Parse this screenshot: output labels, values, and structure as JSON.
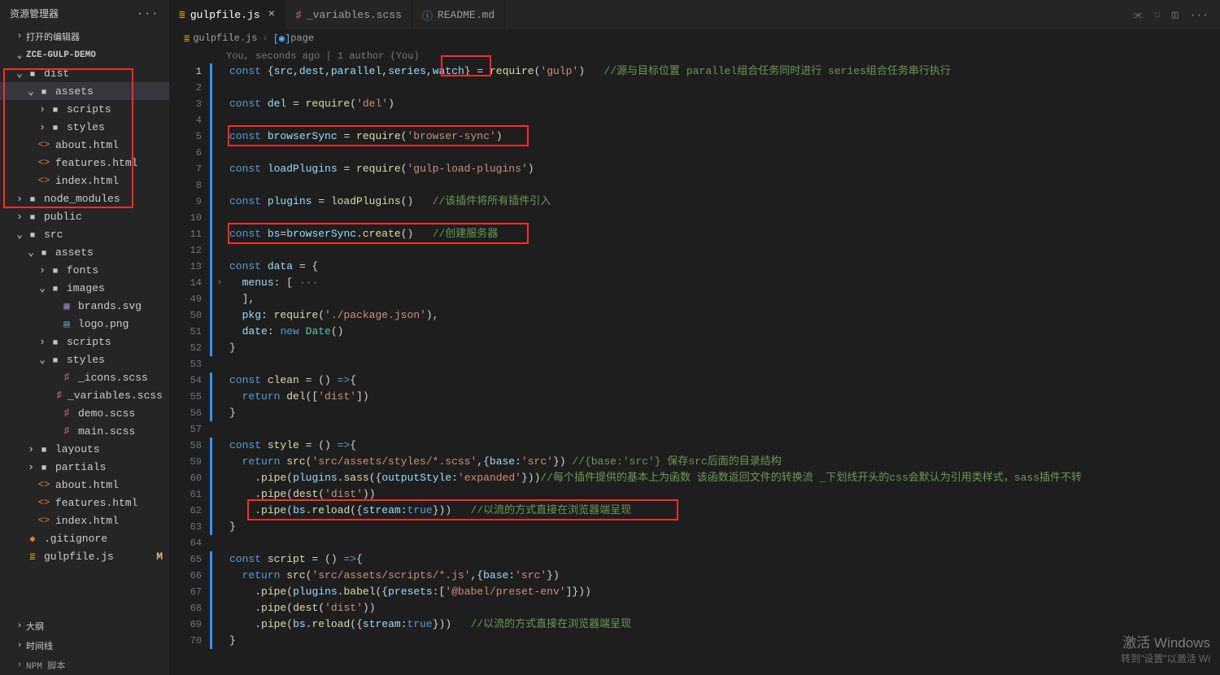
{
  "sidebar": {
    "title": "资源管理器",
    "open_editors": "打开的编辑器",
    "project": "ZCE-GULP-DEMO",
    "outline": "大纲",
    "timeline": "时间线",
    "npm": "NPM 脚本",
    "tree": [
      {
        "d": 1,
        "open": true,
        "icon": "folder",
        "label": "dist"
      },
      {
        "d": 2,
        "open": true,
        "icon": "folder",
        "label": "assets",
        "selected": true
      },
      {
        "d": 3,
        "open": false,
        "icon": "folder",
        "label": "scripts"
      },
      {
        "d": 3,
        "open": false,
        "icon": "folder",
        "label": "styles"
      },
      {
        "d": 2,
        "icon": "html",
        "label": "about.html"
      },
      {
        "d": 2,
        "icon": "html",
        "label": "features.html"
      },
      {
        "d": 2,
        "icon": "html",
        "label": "index.html"
      },
      {
        "d": 1,
        "open": false,
        "icon": "folder",
        "label": "node_modules"
      },
      {
        "d": 1,
        "open": false,
        "icon": "folder",
        "label": "public"
      },
      {
        "d": 1,
        "open": true,
        "icon": "folder",
        "label": "src"
      },
      {
        "d": 2,
        "open": true,
        "icon": "folder",
        "label": "assets"
      },
      {
        "d": 3,
        "open": false,
        "icon": "folder",
        "label": "fonts"
      },
      {
        "d": 3,
        "open": true,
        "icon": "folder",
        "label": "images"
      },
      {
        "d": 4,
        "icon": "svg",
        "label": "brands.svg"
      },
      {
        "d": 4,
        "icon": "png",
        "label": "logo.png"
      },
      {
        "d": 3,
        "open": false,
        "icon": "folder",
        "label": "scripts"
      },
      {
        "d": 3,
        "open": true,
        "icon": "folder",
        "label": "styles"
      },
      {
        "d": 4,
        "icon": "scss",
        "label": "_icons.scss"
      },
      {
        "d": 4,
        "icon": "scss",
        "label": "_variables.scss"
      },
      {
        "d": 4,
        "icon": "scss",
        "label": "demo.scss"
      },
      {
        "d": 4,
        "icon": "scss",
        "label": "main.scss"
      },
      {
        "d": 2,
        "open": false,
        "icon": "folder",
        "label": "layouts"
      },
      {
        "d": 2,
        "open": false,
        "icon": "folder",
        "label": "partials"
      },
      {
        "d": 2,
        "icon": "html",
        "label": "about.html"
      },
      {
        "d": 2,
        "icon": "html",
        "label": "features.html"
      },
      {
        "d": 2,
        "icon": "html",
        "label": "index.html"
      },
      {
        "d": 1,
        "icon": "git",
        "label": ".gitignore"
      },
      {
        "d": 1,
        "icon": "js",
        "label": "gulpfile.js",
        "mod": true
      }
    ]
  },
  "tabs": [
    {
      "icon": "js",
      "label": "gulpfile.js",
      "active": true,
      "close": true
    },
    {
      "icon": "scss",
      "label": "_variables.scss"
    },
    {
      "icon": "info",
      "label": "README.md"
    }
  ],
  "breadcrumb": {
    "file": "gulpfile.js",
    "symbol": "page"
  },
  "codelens": "You, seconds ago | 1 author (You)",
  "line_numbers": [
    "1",
    "2",
    "3",
    "4",
    "5",
    "6",
    "7",
    "8",
    "9",
    "10",
    "11",
    "12",
    "13",
    "14",
    "49",
    "50",
    "51",
    "52",
    "53",
    "54",
    "55",
    "56",
    "57",
    "58",
    "59",
    "60",
    "61",
    "62",
    "63",
    "64",
    "65",
    "66",
    "67",
    "68",
    "69",
    "70"
  ],
  "code": [
    {
      "seg": [
        [
          "k",
          "const "
        ],
        [
          "p",
          "{"
        ],
        [
          "v",
          "src"
        ],
        [
          "p",
          ","
        ],
        [
          "v",
          "dest"
        ],
        [
          "p",
          ","
        ],
        [
          "v",
          "parallel"
        ],
        [
          "p",
          ","
        ],
        [
          "v",
          "series"
        ],
        [
          "p",
          ","
        ],
        [
          "v",
          "watch"
        ],
        [
          "p",
          "} = "
        ],
        [
          "fn",
          "require"
        ],
        [
          "p",
          "("
        ],
        [
          "s",
          "'gulp'"
        ],
        [
          "p",
          ")   "
        ],
        [
          "c",
          "//源与目标位置 parallel组合任务同时进行 series组合任务串行执行"
        ]
      ]
    },
    {
      "seg": []
    },
    {
      "seg": [
        [
          "k",
          "const "
        ],
        [
          "v",
          "del"
        ],
        [
          "p",
          " = "
        ],
        [
          "fn",
          "require"
        ],
        [
          "p",
          "("
        ],
        [
          "s",
          "'del'"
        ],
        [
          "p",
          ")"
        ]
      ]
    },
    {
      "seg": []
    },
    {
      "seg": [
        [
          "k",
          "const "
        ],
        [
          "v",
          "browserSync"
        ],
        [
          "p",
          " = "
        ],
        [
          "fn",
          "require"
        ],
        [
          "p",
          "("
        ],
        [
          "s",
          "'browser-sync'"
        ],
        [
          "p",
          ")"
        ]
      ]
    },
    {
      "seg": []
    },
    {
      "seg": [
        [
          "k",
          "const "
        ],
        [
          "v",
          "loadPlugins"
        ],
        [
          "p",
          " = "
        ],
        [
          "fn",
          "require"
        ],
        [
          "p",
          "("
        ],
        [
          "s",
          "'gulp-load-plugins'"
        ],
        [
          "p",
          ")"
        ]
      ]
    },
    {
      "seg": []
    },
    {
      "seg": [
        [
          "k",
          "const "
        ],
        [
          "v",
          "plugins"
        ],
        [
          "p",
          " = "
        ],
        [
          "fn",
          "loadPlugins"
        ],
        [
          "p",
          "()   "
        ],
        [
          "c",
          "//该插件将所有插件引入"
        ]
      ]
    },
    {
      "seg": []
    },
    {
      "seg": [
        [
          "k",
          "const "
        ],
        [
          "v",
          "bs"
        ],
        [
          "p",
          "="
        ],
        [
          "v",
          "browserSync"
        ],
        [
          "p",
          "."
        ],
        [
          "fn",
          "create"
        ],
        [
          "p",
          "()   "
        ],
        [
          "c",
          "//创建服务器"
        ]
      ]
    },
    {
      "seg": []
    },
    {
      "seg": [
        [
          "k",
          "const "
        ],
        [
          "v",
          "data"
        ],
        [
          "p",
          " = {"
        ]
      ]
    },
    {
      "ind": 1,
      "seg": [
        [
          "v",
          "menus"
        ],
        [
          "p",
          ": [ "
        ],
        [
          "c",
          "···"
        ]
      ]
    },
    {
      "ind": 1,
      "seg": [
        [
          "p",
          "],"
        ]
      ]
    },
    {
      "ind": 1,
      "seg": [
        [
          "v",
          "pkg"
        ],
        [
          "p",
          ": "
        ],
        [
          "fn",
          "require"
        ],
        [
          "p",
          "("
        ],
        [
          "s",
          "'./package.json'"
        ],
        [
          "p",
          "),"
        ]
      ]
    },
    {
      "ind": 1,
      "seg": [
        [
          "v",
          "date"
        ],
        [
          "p",
          ": "
        ],
        [
          "k",
          "new "
        ],
        [
          "t",
          "Date"
        ],
        [
          "p",
          "()"
        ]
      ]
    },
    {
      "seg": [
        [
          "p",
          "}"
        ]
      ]
    },
    {
      "seg": []
    },
    {
      "seg": [
        [
          "k",
          "const "
        ],
        [
          "fn",
          "clean"
        ],
        [
          "p",
          " = () "
        ],
        [
          "k",
          "=>"
        ],
        [
          "p",
          "{"
        ]
      ]
    },
    {
      "ind": 1,
      "seg": [
        [
          "k",
          "return "
        ],
        [
          "fn",
          "del"
        ],
        [
          "p",
          "(["
        ],
        [
          "s",
          "'dist'"
        ],
        [
          "p",
          "])"
        ]
      ]
    },
    {
      "seg": [
        [
          "p",
          "}"
        ]
      ]
    },
    {
      "seg": []
    },
    {
      "seg": [
        [
          "k",
          "const "
        ],
        [
          "fn",
          "style"
        ],
        [
          "p",
          " = () "
        ],
        [
          "k",
          "=>"
        ],
        [
          "p",
          "{"
        ]
      ]
    },
    {
      "ind": 1,
      "seg": [
        [
          "k",
          "return "
        ],
        [
          "fn",
          "src"
        ],
        [
          "p",
          "("
        ],
        [
          "s",
          "'src/assets/styles/*.scss'"
        ],
        [
          "p",
          ",{"
        ],
        [
          "v",
          "base"
        ],
        [
          "p",
          ":"
        ],
        [
          "s",
          "'src'"
        ],
        [
          "p",
          "}) "
        ],
        [
          "c",
          "//{base:'src'} 保存src后面的目录结构"
        ]
      ]
    },
    {
      "ind": 2,
      "seg": [
        [
          "p",
          "."
        ],
        [
          "fn",
          "pipe"
        ],
        [
          "p",
          "("
        ],
        [
          "v",
          "plugins"
        ],
        [
          "p",
          "."
        ],
        [
          "fn",
          "sass"
        ],
        [
          "p",
          "({"
        ],
        [
          "v",
          "outputStyle"
        ],
        [
          "p",
          ":"
        ],
        [
          "s",
          "'expanded'"
        ],
        [
          "p",
          "}))"
        ],
        [
          "c",
          "//每个插件提供的基本上为函数 该函数返回文件的转换流 _下划线开头的css会默认为引用类样式，sass插件不转"
        ]
      ]
    },
    {
      "ind": 2,
      "seg": [
        [
          "p",
          "."
        ],
        [
          "fn",
          "pipe"
        ],
        [
          "p",
          "("
        ],
        [
          "fn",
          "dest"
        ],
        [
          "p",
          "("
        ],
        [
          "s",
          "'dist'"
        ],
        [
          "p",
          "))"
        ]
      ]
    },
    {
      "ind": 2,
      "seg": [
        [
          "p",
          "."
        ],
        [
          "fn",
          "pipe"
        ],
        [
          "p",
          "("
        ],
        [
          "v",
          "bs"
        ],
        [
          "p",
          "."
        ],
        [
          "fn",
          "reload"
        ],
        [
          "p",
          "({"
        ],
        [
          "v",
          "stream"
        ],
        [
          "p",
          ":"
        ],
        [
          "b",
          "true"
        ],
        [
          "p",
          "}))   "
        ],
        [
          "c",
          "//以流的方式直接在浏览器端呈现"
        ]
      ]
    },
    {
      "seg": [
        [
          "p",
          "}"
        ]
      ]
    },
    {
      "seg": []
    },
    {
      "seg": [
        [
          "k",
          "const "
        ],
        [
          "fn",
          "script"
        ],
        [
          "p",
          " = () "
        ],
        [
          "k",
          "=>"
        ],
        [
          "p",
          "{"
        ]
      ]
    },
    {
      "ind": 1,
      "seg": [
        [
          "k",
          "return "
        ],
        [
          "fn",
          "src"
        ],
        [
          "p",
          "("
        ],
        [
          "s",
          "'src/assets/scripts/*.js'"
        ],
        [
          "p",
          ",{"
        ],
        [
          "v",
          "base"
        ],
        [
          "p",
          ":"
        ],
        [
          "s",
          "'src'"
        ],
        [
          "p",
          "})"
        ]
      ]
    },
    {
      "ind": 2,
      "seg": [
        [
          "p",
          "."
        ],
        [
          "fn",
          "pipe"
        ],
        [
          "p",
          "("
        ],
        [
          "v",
          "plugins"
        ],
        [
          "p",
          "."
        ],
        [
          "fn",
          "babel"
        ],
        [
          "p",
          "({"
        ],
        [
          "v",
          "presets"
        ],
        [
          "p",
          ":["
        ],
        [
          "s",
          "'@babel/preset-env'"
        ],
        [
          "p",
          "]}))"
        ]
      ]
    },
    {
      "ind": 2,
      "seg": [
        [
          "p",
          "."
        ],
        [
          "fn",
          "pipe"
        ],
        [
          "p",
          "("
        ],
        [
          "fn",
          "dest"
        ],
        [
          "p",
          "("
        ],
        [
          "s",
          "'dist'"
        ],
        [
          "p",
          "))"
        ]
      ]
    },
    {
      "ind": 2,
      "seg": [
        [
          "p",
          "."
        ],
        [
          "fn",
          "pipe"
        ],
        [
          "p",
          "("
        ],
        [
          "v",
          "bs"
        ],
        [
          "p",
          "."
        ],
        [
          "fn",
          "reload"
        ],
        [
          "p",
          "({"
        ],
        [
          "v",
          "stream"
        ],
        [
          "p",
          ":"
        ],
        [
          "b",
          "true"
        ],
        [
          "p",
          "}))   "
        ],
        [
          "c",
          "//以流的方式直接在浏览器端呈现"
        ]
      ]
    },
    {
      "seg": [
        [
          "p",
          "}"
        ]
      ]
    }
  ],
  "watermark": {
    "big": "激活 Windows",
    "small": "转到\"设置\"以激活 Wi"
  }
}
